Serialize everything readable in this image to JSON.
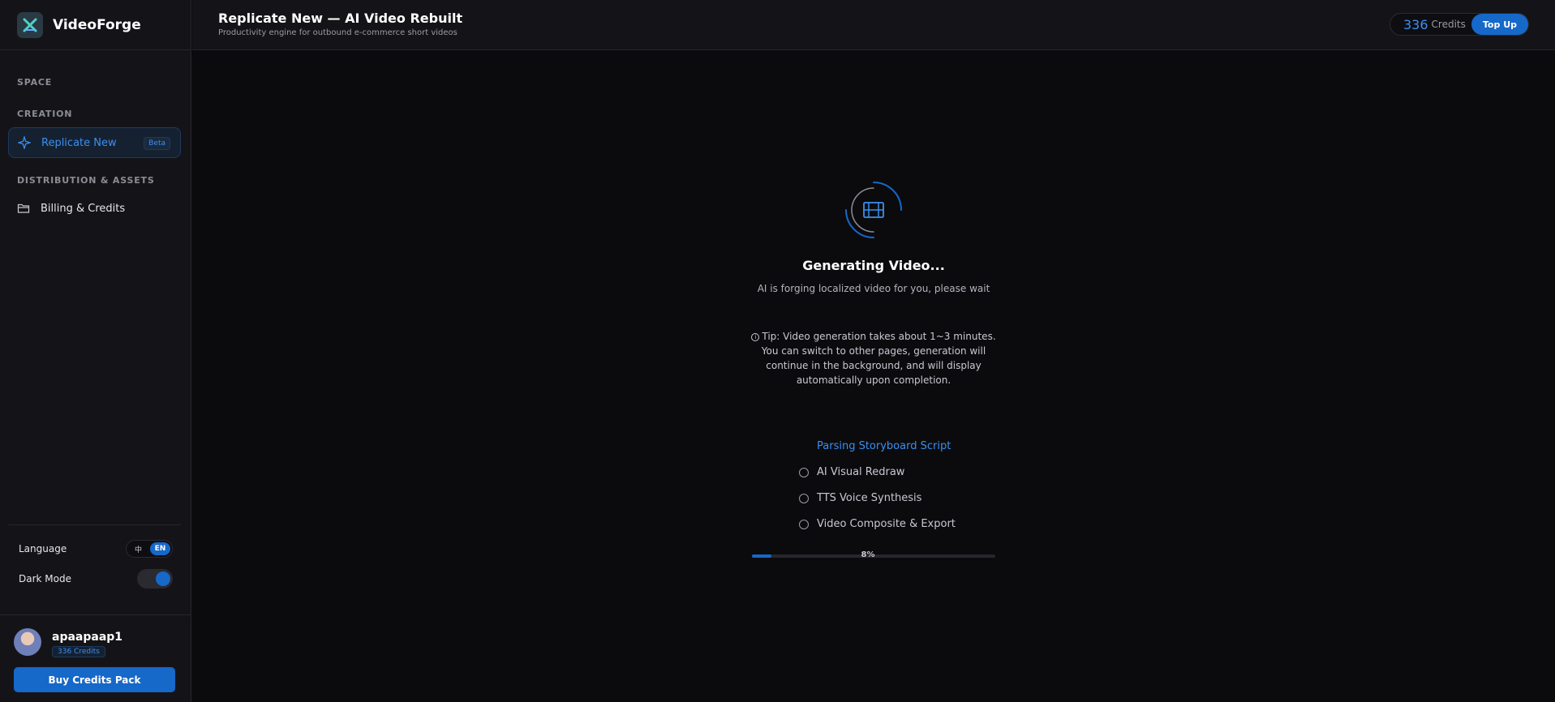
{
  "brand": {
    "name": "VideoForge"
  },
  "sidebar": {
    "sections": [
      {
        "label": "SPACE"
      },
      {
        "label": "CREATION"
      },
      {
        "label": "DISTRIBUTION & ASSETS"
      }
    ],
    "items": [
      {
        "label": "Replicate New",
        "badge": "Beta",
        "icon": "sparkle-icon",
        "active": true
      },
      {
        "label": "Billing & Credits",
        "icon": "folder-icon",
        "active": false
      }
    ],
    "settings": {
      "language_label": "Language",
      "language_options": [
        "中",
        "EN"
      ],
      "language_selected": "EN",
      "dark_mode_label": "Dark Mode",
      "dark_mode_on": true
    },
    "user": {
      "name": "apaapaap1",
      "credits": "336 Credits",
      "buy_button": "Buy Credits Pack"
    }
  },
  "header": {
    "title": "Replicate New — AI Video Rebuilt",
    "subtitle": "Productivity engine for outbound e-commerce short videos",
    "credits_value": "336",
    "credits_label": "Credits",
    "topup_label": "Top Up"
  },
  "main": {
    "status_title": "Generating Video...",
    "status_subtitle": "AI is forging localized video for you, please wait",
    "tip": "Tip: Video generation takes about 1~3 minutes. You can switch to other pages, generation will continue in the background, and will display automatically upon completion.",
    "current_step": "Parsing Storyboard Script",
    "steps": [
      "AI Visual Redraw",
      "TTS Voice Synthesis",
      "Video Composite & Export"
    ],
    "progress_percent": 8,
    "progress_label": "8%"
  },
  "colors": {
    "accent": "#1668c9",
    "accent_text": "#3b8ff0",
    "background": "#0b0b0e",
    "panel": "#141418"
  }
}
